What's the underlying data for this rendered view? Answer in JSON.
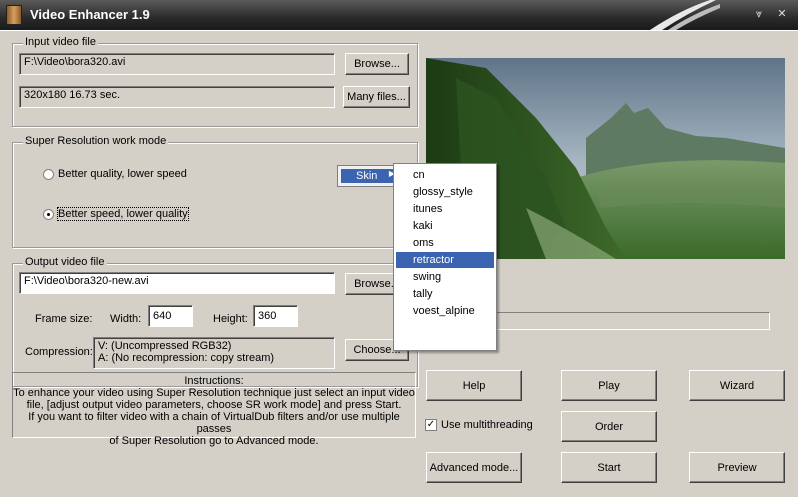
{
  "window": {
    "title": "Video Enhancer 1.9"
  },
  "input": {
    "legend": "Input video file",
    "path": "F:\\Video\\bora320.avi",
    "info": "320x180 16.73 sec.",
    "browse_label": "Browse...",
    "many_files_label": "Many files..."
  },
  "sr": {
    "legend": "Super Resolution work mode",
    "options": [
      {
        "label": "Better quality, lower speed",
        "selected": false
      },
      {
        "label": "Better speed, lower quality",
        "selected": true
      }
    ]
  },
  "output": {
    "legend": "Output video file",
    "path": "F:\\Video\\bora320-new.avi",
    "browse_label": "Browse...",
    "frame_size_label": "Frame size:",
    "width_label": "Width:",
    "width_value": "640",
    "height_label": "Height:",
    "height_value": "360",
    "compression_label": "Compression:",
    "compression_video": "V: (Uncompressed RGB32)",
    "compression_audio": "A: (No recompression: copy stream)",
    "choose_label": "Choose..."
  },
  "instructions": {
    "title": "Instructions:",
    "line1": "To enhance your video using Super Resolution technique just select an input video",
    "line2": "file, [adjust output video parameters, choose SR work mode] and press Start.",
    "line3": "If you want to filter video with a chain of VirtualDub filters and/or use multiple passes",
    "line4": "of Super Resolution go to Advanced mode."
  },
  "buttons": {
    "help": "Help",
    "play": "Play",
    "wizard": "Wizard",
    "order": "Order",
    "advanced": "Advanced mode...",
    "start": "Start",
    "preview": "Preview"
  },
  "multithreading": {
    "label": "Use multithreading",
    "checked": true
  },
  "context_menu": {
    "skin_label": "Skin",
    "skins": [
      "cn",
      "glossy_style",
      "itunes",
      "kaki",
      "oms",
      "retractor",
      "swing",
      "tally",
      "voest_alpine"
    ],
    "selected_index": 5
  }
}
